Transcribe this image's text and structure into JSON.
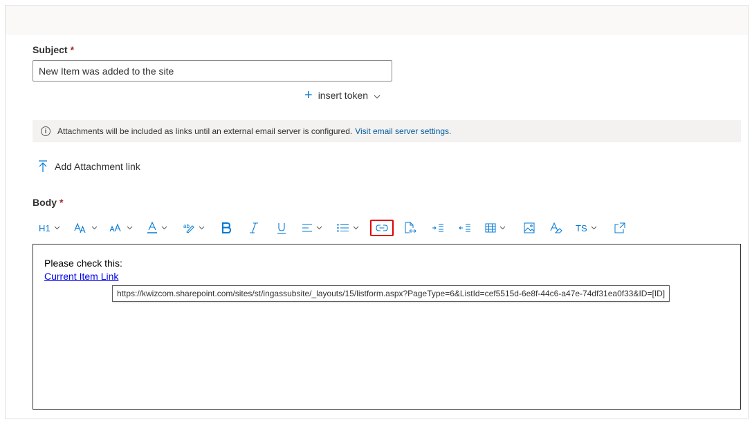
{
  "subject": {
    "label": "Subject",
    "required_mark": "*",
    "value": "New Item was added to the site"
  },
  "insert_token": {
    "label": "insert token"
  },
  "message_bar": {
    "text": "Attachments will be included as links until an external email server is configured.",
    "link": "Visit email server settings."
  },
  "attachment": {
    "label": "Add Attachment link"
  },
  "body": {
    "label": "Body",
    "required_mark": "*",
    "line1": "Please check this:",
    "link_text": "Current Item Link",
    "tooltip": "https://kwizcom.sharepoint.com/sites/st/ingassubsite/_layouts/15/listform.aspx?PageType=6&ListId=cef5515d-6e8f-44c6-a47e-74df31ea0f33&ID=[ID]"
  },
  "toolbar": {
    "heading": "H1",
    "text_style": "TS"
  },
  "colors": {
    "accent": "#0078d4",
    "required": "#a4262c",
    "highlight_border": "#e00000",
    "link": "#005a9e"
  }
}
